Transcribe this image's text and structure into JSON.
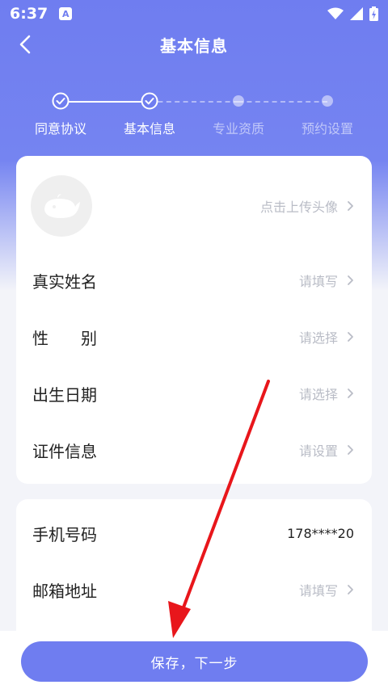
{
  "status_bar": {
    "time": "6:37",
    "app_badge": "A"
  },
  "nav": {
    "title": "基本信息"
  },
  "steps": [
    {
      "label": "同意协议",
      "state": "done"
    },
    {
      "label": "基本信息",
      "state": "done"
    },
    {
      "label": "专业资质",
      "state": "todo"
    },
    {
      "label": "预约设置",
      "state": "todo"
    }
  ],
  "avatar_row": {
    "hint": "点击上传头像"
  },
  "basic_fields": [
    {
      "label": "真实姓名",
      "value": "请填写"
    },
    {
      "label": "性　　别",
      "value": "请选择"
    },
    {
      "label": "出生日期",
      "value": "请选择"
    },
    {
      "label": "证件信息",
      "value": "请设置"
    }
  ],
  "contact_fields": [
    {
      "label": "手机号码",
      "value": "178****20"
    },
    {
      "label": "邮箱地址",
      "value": "请填写"
    }
  ],
  "footer": {
    "save_label": "保存，下一步"
  },
  "colors": {
    "primary": "#6f7df0",
    "placeholder": "#b9bcc6",
    "annotation": "#e8161b"
  },
  "icons": [
    "back-arrow-icon",
    "check-circle-icon",
    "whale-avatar-icon",
    "chevron-right-icon",
    "wifi-icon",
    "signal-icon",
    "battery-icon"
  ]
}
